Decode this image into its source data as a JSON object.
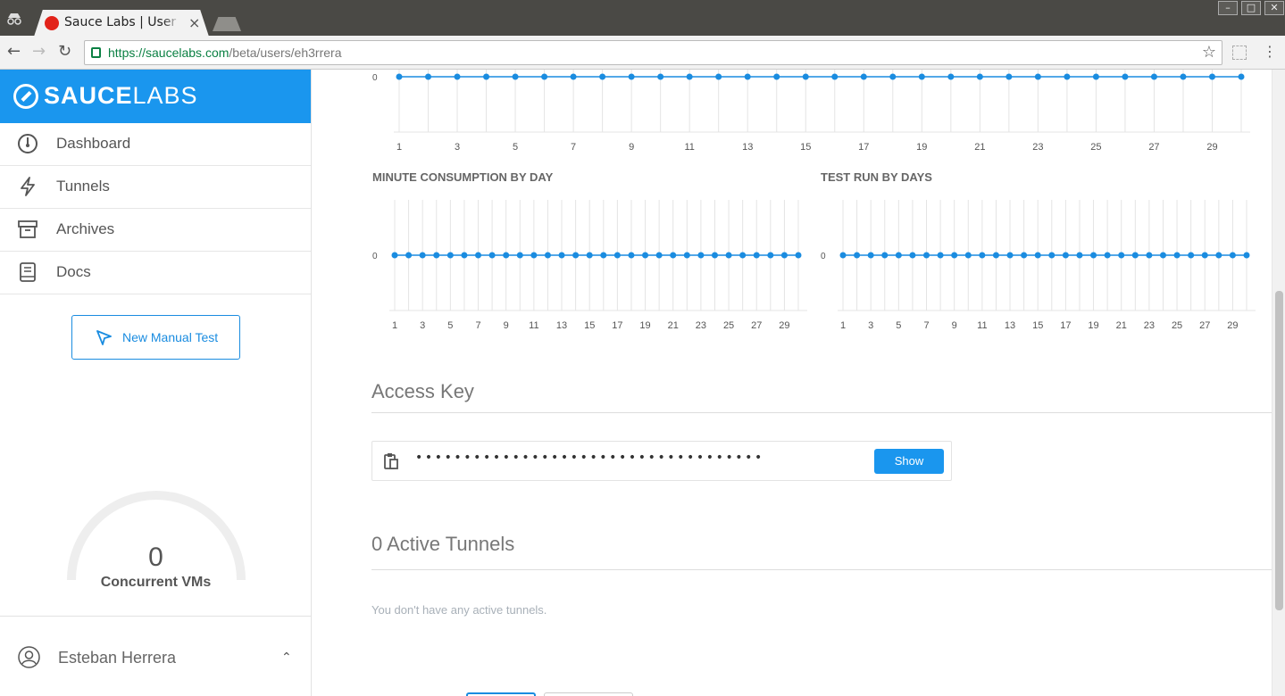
{
  "browser": {
    "tab_title": "Sauce Labs | User Dashboard",
    "tab_close": "×",
    "url_host": "https://saucelabs.com",
    "url_path": "/beta/users/eh3rrera",
    "window_controls": [
      "–",
      "□",
      "✕"
    ],
    "nav": {
      "back": "←",
      "forward": "→",
      "reload": "↻"
    },
    "star": "☆",
    "menu": "⋮"
  },
  "sidebar": {
    "brand_bold": "SAUCE",
    "brand_light": "LABS",
    "items": [
      {
        "label": "Dashboard",
        "icon": "gauge-icon"
      },
      {
        "label": "Tunnels",
        "icon": "lightning-icon"
      },
      {
        "label": "Archives",
        "icon": "archive-box-icon"
      },
      {
        "label": "Docs",
        "icon": "book-icon"
      }
    ],
    "new_test_label": "New Manual Test",
    "gauge_value": "0",
    "gauge_label": "Concurrent VMs",
    "user_name": "Esteban Herrera",
    "user_chevron": "⌃"
  },
  "main": {
    "access_key_title": "Access Key",
    "access_key_mask": "••••••••••••••••••••••••••••••••••••",
    "show_button": "Show",
    "tunnels_title": "0 Active Tunnels",
    "no_tunnels_text": "You don't have any active tunnels."
  },
  "colors": {
    "brand": "#1a96ee",
    "series": "#1a8ce0",
    "grid": "#e4e4e4"
  },
  "chart_data": [
    {
      "type": "line",
      "title": "",
      "x": [
        1,
        2,
        3,
        4,
        5,
        6,
        7,
        8,
        9,
        10,
        11,
        12,
        13,
        14,
        15,
        16,
        17,
        18,
        19,
        20,
        21,
        22,
        23,
        24,
        25,
        26,
        27,
        28,
        29,
        30
      ],
      "x_tick_labels": [
        "1",
        "3",
        "5",
        "7",
        "9",
        "11",
        "13",
        "15",
        "17",
        "19",
        "21",
        "23",
        "25",
        "27",
        "29"
      ],
      "y_tick_labels": [
        "0"
      ],
      "series": [
        {
          "values": [
            0,
            0,
            0,
            0,
            0,
            0,
            0,
            0,
            0,
            0,
            0,
            0,
            0,
            0,
            0,
            0,
            0,
            0,
            0,
            0,
            0,
            0,
            0,
            0,
            0,
            0,
            0,
            0,
            0,
            0
          ]
        }
      ],
      "grid": true
    },
    {
      "type": "line",
      "title": "MINUTE CONSUMPTION BY DAY",
      "x": [
        1,
        2,
        3,
        4,
        5,
        6,
        7,
        8,
        9,
        10,
        11,
        12,
        13,
        14,
        15,
        16,
        17,
        18,
        19,
        20,
        21,
        22,
        23,
        24,
        25,
        26,
        27,
        28,
        29,
        30
      ],
      "x_tick_labels": [
        "1",
        "3",
        "5",
        "7",
        "9",
        "11",
        "13",
        "15",
        "17",
        "19",
        "21",
        "23",
        "25",
        "27",
        "29"
      ],
      "y_tick_labels": [
        "0"
      ],
      "series": [
        {
          "values": [
            0,
            0,
            0,
            0,
            0,
            0,
            0,
            0,
            0,
            0,
            0,
            0,
            0,
            0,
            0,
            0,
            0,
            0,
            0,
            0,
            0,
            0,
            0,
            0,
            0,
            0,
            0,
            0,
            0,
            0
          ]
        }
      ],
      "grid": true
    },
    {
      "type": "line",
      "title": "TEST RUN BY DAYS",
      "x": [
        1,
        2,
        3,
        4,
        5,
        6,
        7,
        8,
        9,
        10,
        11,
        12,
        13,
        14,
        15,
        16,
        17,
        18,
        19,
        20,
        21,
        22,
        23,
        24,
        25,
        26,
        27,
        28,
        29,
        30
      ],
      "x_tick_labels": [
        "1",
        "3",
        "5",
        "7",
        "9",
        "11",
        "13",
        "15",
        "17",
        "19",
        "21",
        "23",
        "25",
        "27",
        "29"
      ],
      "y_tick_labels": [
        "0"
      ],
      "series": [
        {
          "values": [
            0,
            0,
            0,
            0,
            0,
            0,
            0,
            0,
            0,
            0,
            0,
            0,
            0,
            0,
            0,
            0,
            0,
            0,
            0,
            0,
            0,
            0,
            0,
            0,
            0,
            0,
            0,
            0,
            0,
            0
          ]
        }
      ],
      "grid": true
    }
  ]
}
